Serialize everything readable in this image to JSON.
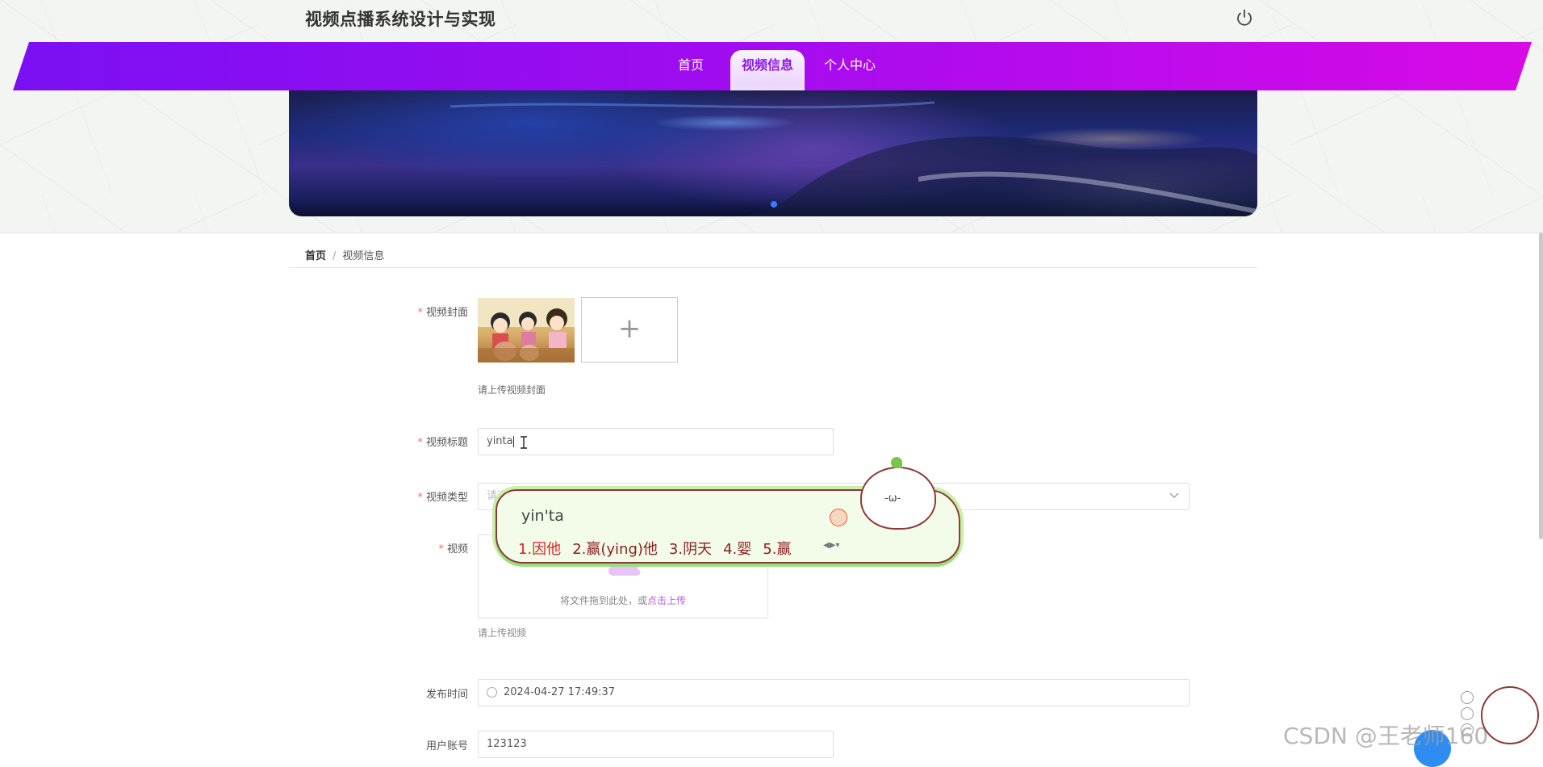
{
  "header": {
    "site_title": "视频点播系统设计与实现"
  },
  "nav": {
    "items": [
      {
        "label": "首页"
      },
      {
        "label": "视频信息"
      },
      {
        "label": "个人中心"
      }
    ]
  },
  "breadcrumb": {
    "home": "首页",
    "separator": "/",
    "current": "视频信息"
  },
  "form": {
    "cover": {
      "label": "视频封面",
      "add_symbol": "+",
      "hint": "请上传视频封面"
    },
    "title": {
      "label": "视频标题",
      "value": "yinta"
    },
    "type": {
      "label": "视频类型",
      "placeholder": "请选择"
    },
    "video": {
      "label": "视频",
      "drag_text": "将文件拖到此处，或",
      "upload_link": "点击上传",
      "hint": "请上传视频"
    },
    "publish_time": {
      "label": "发布时间",
      "value": "2024-04-27 17:49:37"
    },
    "account": {
      "label": "用户账号",
      "value": "123123"
    }
  },
  "ime": {
    "composition": "yin'ta",
    "candidates": [
      "1.因他",
      "2.赢(ying)他",
      "3.阴天",
      "4.婴",
      "5.赢"
    ],
    "mascot_face": "-ω-"
  },
  "watermark": {
    "text": "CSDN @王老师160"
  },
  "colors": {
    "nav_start": "#7a10f2",
    "nav_end": "#d80ae6",
    "required": "#f56c6c",
    "link": "#b35fe6",
    "ime_candidate": "#8b1e1e"
  }
}
